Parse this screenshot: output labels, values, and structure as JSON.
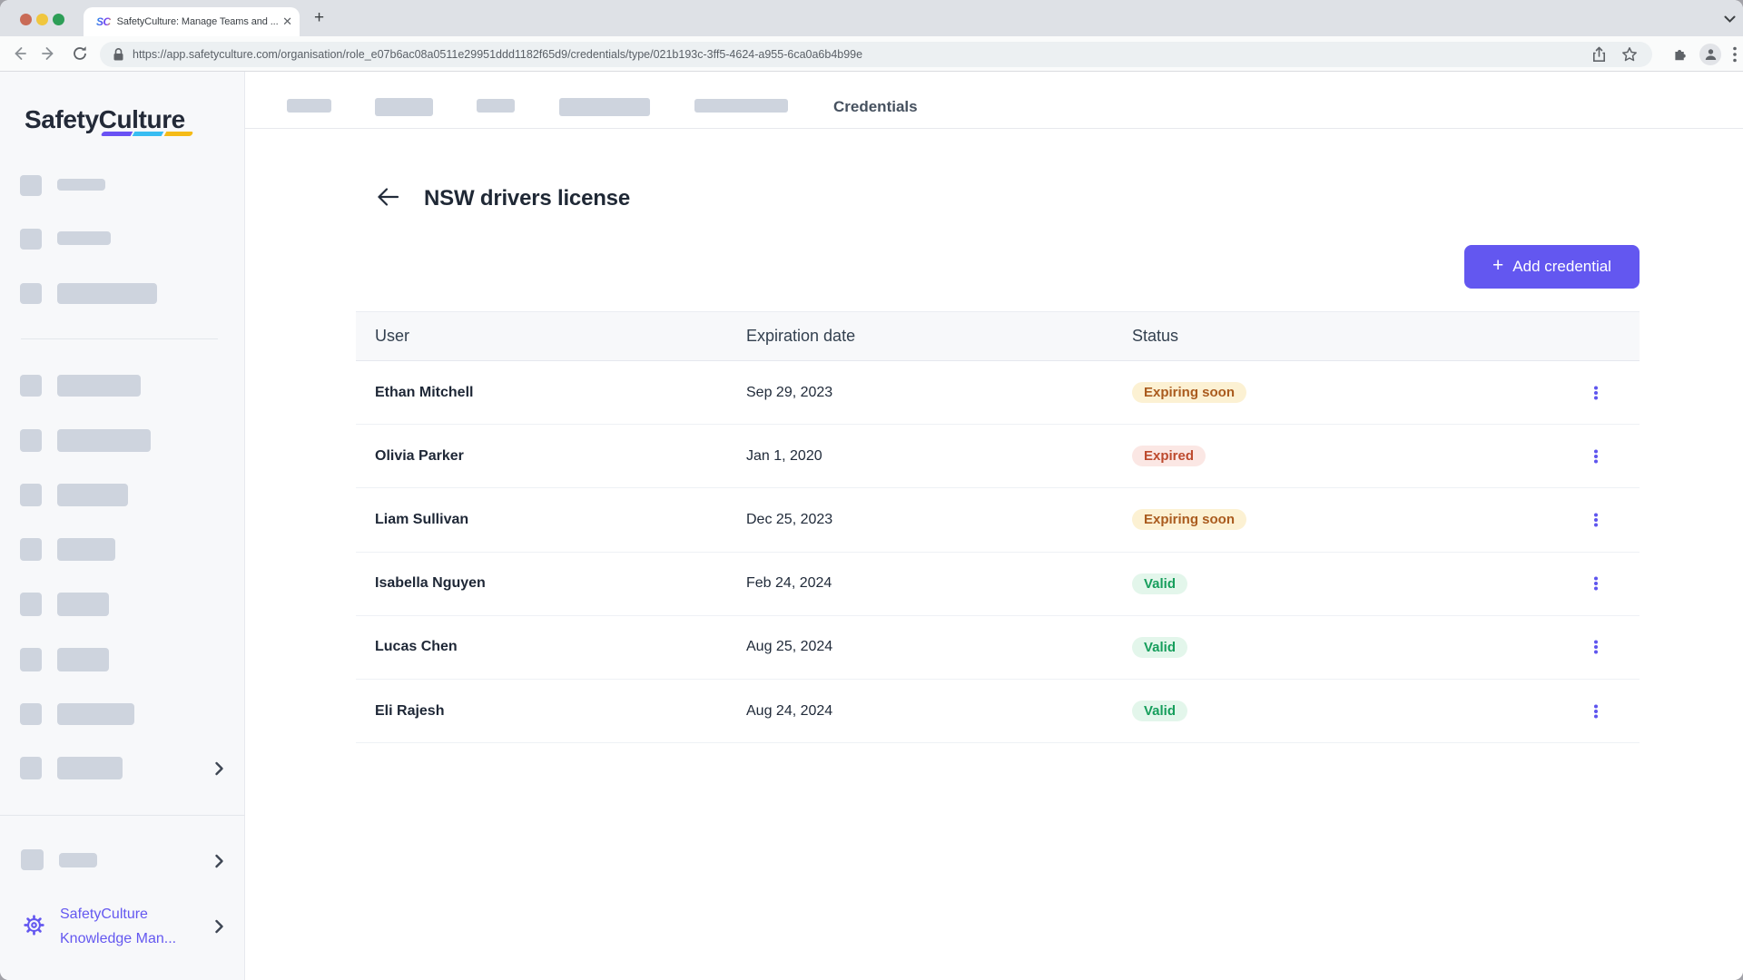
{
  "browser": {
    "tab_title": "SafetyCulture: Manage Teams and ...",
    "tab_close": "✕",
    "favicon_text": "SC",
    "new_tab": "+",
    "url": "https://app.safetyculture.com/organisation/role_e07b6ac08a0511e29951ddd1182f65d9/credentials/type/021b193c-3ff5-4624-a955-6ca0a6b4b99e"
  },
  "sidebar": {
    "logo_part1": "Safety",
    "logo_part2": "Culture",
    "footer_line1": "SafetyCulture",
    "footer_line2": "Knowledge Man..."
  },
  "nav": {
    "active_label": "Credentials"
  },
  "page": {
    "title": "NSW drivers license",
    "add_button": "Add credential",
    "plus": "+"
  },
  "table": {
    "headers": [
      "User",
      "Expiration date",
      "Status"
    ],
    "rows": [
      {
        "user": "Ethan Mitchell",
        "expiration": "Sep 29, 2023",
        "status": "Expiring soon",
        "status_type": "warning"
      },
      {
        "user": "Olivia Parker",
        "expiration": "Jan 1, 2020",
        "status": "Expired",
        "status_type": "danger"
      },
      {
        "user": "Liam Sullivan",
        "expiration": "Dec 25, 2023",
        "status": "Expiring soon",
        "status_type": "warning"
      },
      {
        "user": "Isabella Nguyen",
        "expiration": "Feb 24, 2024",
        "status": "Valid",
        "status_type": "success"
      },
      {
        "user": "Lucas Chen",
        "expiration": "Aug 25, 2024",
        "status": "Valid",
        "status_type": "success"
      },
      {
        "user": "Eli Rajesh",
        "expiration": "Aug 24, 2024",
        "status": "Valid",
        "status_type": "success"
      }
    ]
  },
  "colors": {
    "accent_purple": "#6357f0",
    "badge_warning_bg": "#fcf1d3",
    "badge_warning_text": "#aa5b1e",
    "badge_danger_bg": "#fbe7e4",
    "badge_danger_text": "#bd4a2e",
    "badge_success_bg": "#e3f6eb",
    "badge_success_text": "#169e5c"
  }
}
